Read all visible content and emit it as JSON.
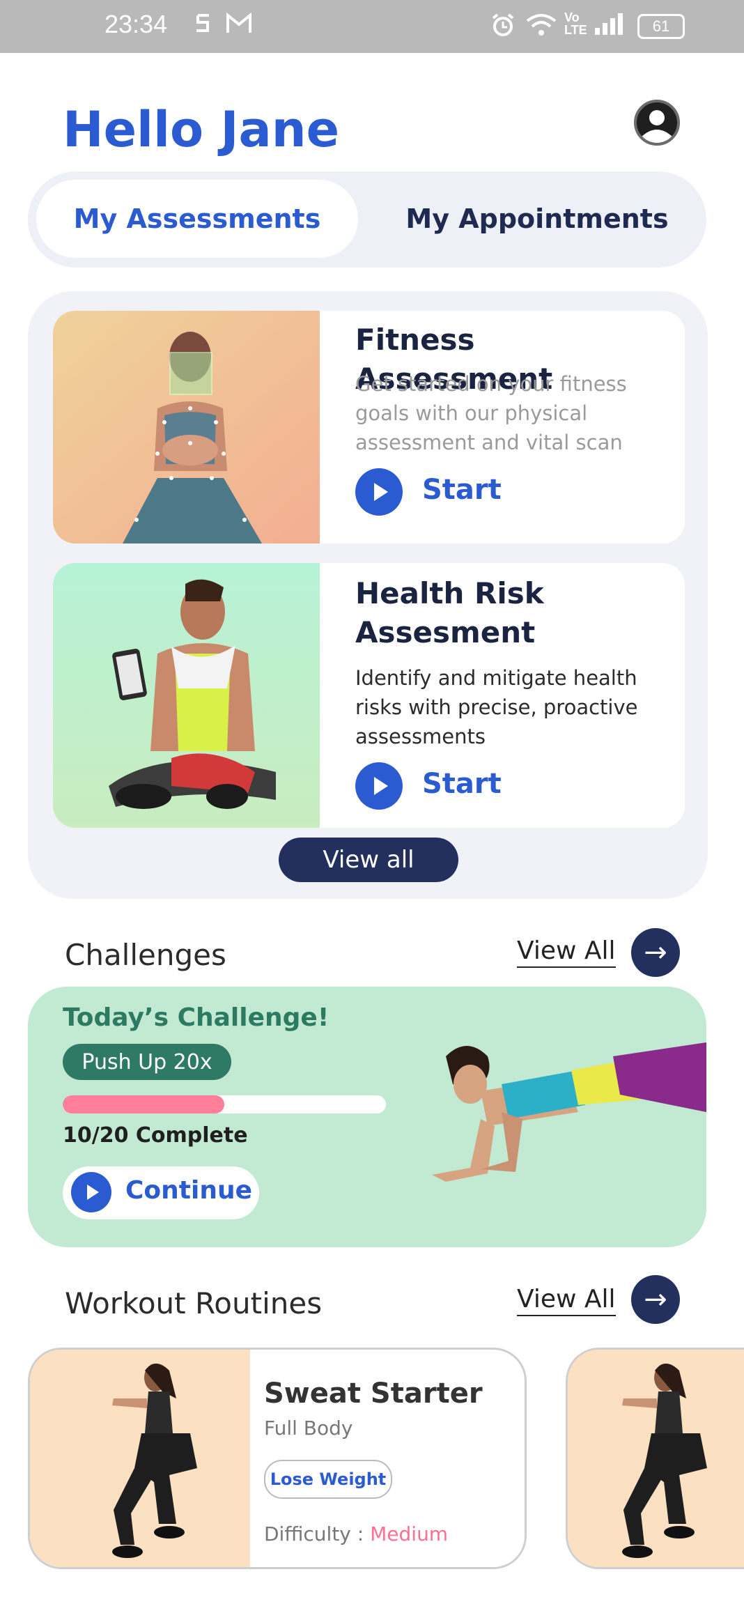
{
  "status_bar": {
    "time": "23:34",
    "battery": "61",
    "icons": [
      "s-notification-icon",
      "gmail-icon",
      "alarm-icon",
      "wifi-icon",
      "volte-icon",
      "signal-icon",
      "battery-icon"
    ]
  },
  "header": {
    "greeting": "Hello Jane",
    "profile_icon": "account-circle-icon"
  },
  "tabs": [
    {
      "label": "My Assessments",
      "active": true
    },
    {
      "label": "My Appointments",
      "active": false
    }
  ],
  "assessments": [
    {
      "title": "Fitness Assessment",
      "description": "Get started on your fitness goals with our physical assessment and vital scan",
      "action": "Start"
    },
    {
      "title": "Health Risk Assesment",
      "description": "Identify and mitigate health risks with precise, proactive assessments",
      "action": "Start"
    }
  ],
  "assessments_view_all": "View all",
  "challenges": {
    "section_title": "Challenges",
    "view_all": "View All",
    "card": {
      "title": "Today’s Challenge!",
      "exercise": "Push Up 20x",
      "progress_fraction": 0.5,
      "complete_text": "10/20 Complete",
      "action": "Continue"
    }
  },
  "workouts": {
    "section_title": "Workout Routines",
    "view_all": "View All",
    "items": [
      {
        "title": "Sweat Starter",
        "subtitle": "Full Body",
        "tag": "Lose Weight",
        "difficulty_label": "Difficulty : ",
        "difficulty_value": "Medium"
      }
    ]
  },
  "colors": {
    "brand_blue": "#2a5bd0",
    "navy": "#23305e",
    "challenge_bg": "#c2e9d2",
    "progress": "#ff7f9b"
  }
}
